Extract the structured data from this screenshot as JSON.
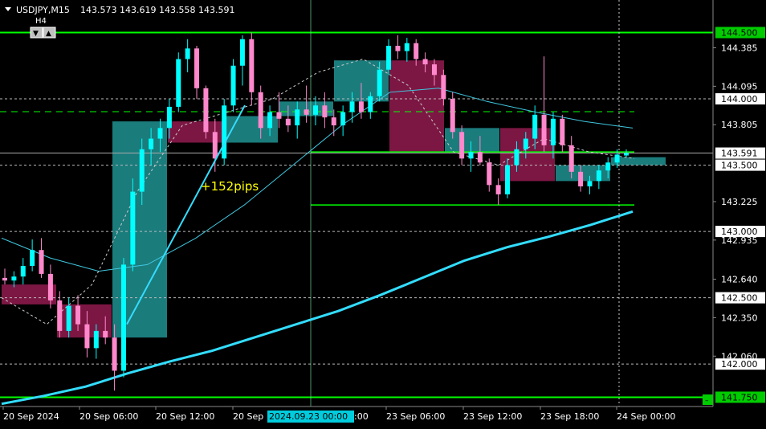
{
  "header": {
    "symbol": "USDJPY,M15",
    "ohlc": "143.573 143.619 143.558 143.591",
    "tf_label": "H4",
    "btn_down": "▼",
    "btn_up": "▲"
  },
  "annotation": {
    "text": "+152pips",
    "color": "#ffff00"
  },
  "colors": {
    "background": "#000000",
    "bull": "#00ffff",
    "bear": "#ff88cc",
    "box_bull": "#1e8a8a",
    "box_bear": "#8a1a4a",
    "level_line": "#00ff00",
    "ma_slow": "#33ddff",
    "ma_mid": "#40c8e0",
    "ma_fast": "#cccccc",
    "price_line": "#aaaaaa"
  },
  "chart_data": {
    "type": "candlestick",
    "symbol": "USDJPY",
    "timeframe": "M15",
    "ylim": [
      141.68,
      144.6
    ],
    "y_tick_labels": [
      "144.385",
      "144.095",
      "143.805",
      "143.225",
      "142.935",
      "142.640",
      "142.350",
      "142.060"
    ],
    "x_tick_labels": [
      "20 Sep 2024",
      "20 Sep 06:00",
      "20 Sep 12:00",
      "20 Sep",
      "23 Sep 06:00",
      "23 Sep 12:00",
      "23 Sep 18:00",
      "24 Sep 00:00"
    ],
    "x_tick_partial": ":00",
    "crosshair_time_label": "2024.09.23 00:00",
    "levels": [
      {
        "price": 144.5,
        "label": "144.500",
        "style": "solid-green"
      },
      {
        "price": 144.0,
        "label": "144.000",
        "style": "dotted-white"
      },
      {
        "price": 143.5,
        "label": "143.500",
        "style": "dotted-white"
      },
      {
        "price": 143.0,
        "label": "143.000",
        "style": "dotted-white"
      },
      {
        "price": 142.5,
        "label": "142.500",
        "style": "dotted-white"
      },
      {
        "price": 142.0,
        "label": "142.000",
        "style": "dotted-white"
      },
      {
        "price": 141.75,
        "label": "141.750",
        "style": "solid-green"
      }
    ],
    "current_price": {
      "price": 143.591,
      "label": "143.591"
    },
    "h4_boxes": [
      {
        "o": 142.6,
        "h": 142.9,
        "l": 142.3,
        "c": 142.45
      },
      {
        "o": 142.45,
        "h": 142.6,
        "l": 142.06,
        "c": 142.2
      },
      {
        "o": 142.2,
        "h": 143.83,
        "l": 141.8,
        "c": 143.83
      },
      {
        "o": 143.83,
        "h": 144.4,
        "l": 143.5,
        "c": 143.67
      },
      {
        "o": 143.67,
        "h": 144.3,
        "l": 143.6,
        "c": 143.87
      },
      {
        "o": 143.87,
        "h": 144.08,
        "l": 143.7,
        "c": 143.98
      },
      {
        "o": 143.98,
        "h": 144.45,
        "l": 143.9,
        "c": 144.29
      },
      {
        "o": 144.29,
        "h": 144.3,
        "l": 143.5,
        "c": 143.6
      },
      {
        "o": 143.6,
        "h": 143.8,
        "l": 143.3,
        "c": 143.78
      },
      {
        "o": 143.78,
        "h": 144.2,
        "l": 143.3,
        "c": 143.38
      },
      {
        "o": 143.38,
        "h": 143.6,
        "l": 143.28,
        "c": 143.5
      },
      {
        "o": 143.5,
        "h": 143.62,
        "l": 143.45,
        "c": 143.56
      }
    ],
    "ma_slow": [
      141.7,
      141.76,
      141.83,
      141.93,
      142.02,
      142.1,
      142.2,
      142.3,
      142.4,
      142.52,
      142.65,
      142.78,
      142.88,
      142.96,
      143.05,
      143.15
    ],
    "ma_mid": [
      142.95,
      142.8,
      142.7,
      142.75,
      142.95,
      143.2,
      143.5,
      143.8,
      144.05,
      144.08,
      143.98,
      143.9,
      143.83,
      143.78
    ],
    "ma_fast": [
      142.5,
      142.3,
      142.6,
      143.3,
      143.8,
      143.9,
      144.0,
      144.2,
      144.3,
      144.1,
      143.6,
      143.5,
      143.7,
      143.6,
      143.55
    ],
    "trend_line": {
      "from": 142.3,
      "to": 144.0,
      "label": "+152pips"
    },
    "green_levels_short": [
      144.5,
      143.6,
      143.2
    ],
    "dashed_level": 144.0,
    "candles": [
      {
        "o": 142.65,
        "h": 142.72,
        "l": 142.6,
        "c": 142.63
      },
      {
        "o": 142.63,
        "h": 142.7,
        "l": 142.58,
        "c": 142.66
      },
      {
        "o": 142.66,
        "h": 142.8,
        "l": 142.6,
        "c": 142.74
      },
      {
        "o": 142.74,
        "h": 142.94,
        "l": 142.7,
        "c": 142.86
      },
      {
        "o": 142.86,
        "h": 142.95,
        "l": 142.65,
        "c": 142.68
      },
      {
        "o": 142.68,
        "h": 142.75,
        "l": 142.42,
        "c": 142.48
      },
      {
        "o": 142.48,
        "h": 142.55,
        "l": 142.2,
        "c": 142.25
      },
      {
        "o": 142.25,
        "h": 142.5,
        "l": 142.2,
        "c": 142.44
      },
      {
        "o": 142.44,
        "h": 142.52,
        "l": 142.25,
        "c": 142.3
      },
      {
        "o": 142.3,
        "h": 142.4,
        "l": 142.05,
        "c": 142.12
      },
      {
        "o": 142.12,
        "h": 142.3,
        "l": 142.04,
        "c": 142.25
      },
      {
        "o": 142.25,
        "h": 142.36,
        "l": 142.15,
        "c": 142.2
      },
      {
        "o": 142.2,
        "h": 142.3,
        "l": 141.8,
        "c": 141.95
      },
      {
        "o": 141.95,
        "h": 142.8,
        "l": 141.9,
        "c": 142.75
      },
      {
        "o": 142.75,
        "h": 143.4,
        "l": 142.7,
        "c": 143.3
      },
      {
        "o": 143.3,
        "h": 143.7,
        "l": 143.2,
        "c": 143.62
      },
      {
        "o": 143.62,
        "h": 143.78,
        "l": 143.5,
        "c": 143.7
      },
      {
        "o": 143.7,
        "h": 143.85,
        "l": 143.6,
        "c": 143.78
      },
      {
        "o": 143.78,
        "h": 144.0,
        "l": 143.7,
        "c": 143.94
      },
      {
        "o": 143.94,
        "h": 144.35,
        "l": 143.9,
        "c": 144.3
      },
      {
        "o": 144.3,
        "h": 144.45,
        "l": 144.2,
        "c": 144.38
      },
      {
        "o": 144.38,
        "h": 144.4,
        "l": 144.0,
        "c": 144.08
      },
      {
        "o": 144.08,
        "h": 144.1,
        "l": 143.7,
        "c": 143.75
      },
      {
        "o": 143.75,
        "h": 143.85,
        "l": 143.45,
        "c": 143.55
      },
      {
        "o": 143.55,
        "h": 144.0,
        "l": 143.5,
        "c": 143.95
      },
      {
        "o": 143.95,
        "h": 144.3,
        "l": 143.9,
        "c": 144.25
      },
      {
        "o": 144.25,
        "h": 144.48,
        "l": 144.1,
        "c": 144.45
      },
      {
        "o": 144.45,
        "h": 144.5,
        "l": 143.95,
        "c": 144.05
      },
      {
        "o": 144.05,
        "h": 144.1,
        "l": 143.7,
        "c": 143.78
      },
      {
        "o": 143.78,
        "h": 143.95,
        "l": 143.72,
        "c": 143.9
      },
      {
        "o": 143.9,
        "h": 144.05,
        "l": 143.78,
        "c": 143.85
      },
      {
        "o": 143.85,
        "h": 143.95,
        "l": 143.75,
        "c": 143.8
      },
      {
        "o": 143.8,
        "h": 143.98,
        "l": 143.7,
        "c": 143.92
      },
      {
        "o": 143.92,
        "h": 144.1,
        "l": 143.82,
        "c": 143.88
      },
      {
        "o": 143.88,
        "h": 144.02,
        "l": 143.8,
        "c": 143.95
      },
      {
        "o": 143.95,
        "h": 144.05,
        "l": 143.78,
        "c": 143.86
      },
      {
        "o": 143.86,
        "h": 143.92,
        "l": 143.72,
        "c": 143.8
      },
      {
        "o": 143.8,
        "h": 143.95,
        "l": 143.72,
        "c": 143.9
      },
      {
        "o": 143.9,
        "h": 144.05,
        "l": 143.82,
        "c": 143.98
      },
      {
        "o": 143.98,
        "h": 144.12,
        "l": 143.85,
        "c": 143.9
      },
      {
        "o": 143.9,
        "h": 144.05,
        "l": 143.85,
        "c": 144.02
      },
      {
        "o": 144.02,
        "h": 144.28,
        "l": 143.98,
        "c": 144.22
      },
      {
        "o": 144.22,
        "h": 144.45,
        "l": 144.18,
        "c": 144.4
      },
      {
        "o": 144.4,
        "h": 144.48,
        "l": 144.3,
        "c": 144.36
      },
      {
        "o": 144.36,
        "h": 144.46,
        "l": 144.28,
        "c": 144.42
      },
      {
        "o": 144.42,
        "h": 144.45,
        "l": 144.25,
        "c": 144.3
      },
      {
        "o": 144.3,
        "h": 144.35,
        "l": 144.2,
        "c": 144.26
      },
      {
        "o": 144.26,
        "h": 144.3,
        "l": 144.1,
        "c": 144.18
      },
      {
        "o": 144.18,
        "h": 144.22,
        "l": 143.95,
        "c": 144.0
      },
      {
        "o": 144.0,
        "h": 144.05,
        "l": 143.7,
        "c": 143.75
      },
      {
        "o": 143.75,
        "h": 143.8,
        "l": 143.5,
        "c": 143.55
      },
      {
        "o": 143.55,
        "h": 143.68,
        "l": 143.45,
        "c": 143.6
      },
      {
        "o": 143.6,
        "h": 143.72,
        "l": 143.5,
        "c": 143.52
      },
      {
        "o": 143.52,
        "h": 143.55,
        "l": 143.3,
        "c": 143.35
      },
      {
        "o": 143.35,
        "h": 143.4,
        "l": 143.2,
        "c": 143.28
      },
      {
        "o": 143.28,
        "h": 143.55,
        "l": 143.25,
        "c": 143.5
      },
      {
        "o": 143.5,
        "h": 143.68,
        "l": 143.45,
        "c": 143.62
      },
      {
        "o": 143.62,
        "h": 143.75,
        "l": 143.55,
        "c": 143.7
      },
      {
        "o": 143.7,
        "h": 143.95,
        "l": 143.62,
        "c": 143.88
      },
      {
        "o": 143.88,
        "h": 144.32,
        "l": 143.6,
        "c": 143.65
      },
      {
        "o": 143.65,
        "h": 143.9,
        "l": 143.55,
        "c": 143.85
      },
      {
        "o": 143.85,
        "h": 143.88,
        "l": 143.6,
        "c": 143.65
      },
      {
        "o": 143.65,
        "h": 143.72,
        "l": 143.4,
        "c": 143.45
      },
      {
        "o": 143.45,
        "h": 143.5,
        "l": 143.3,
        "c": 143.34
      },
      {
        "o": 143.34,
        "h": 143.42,
        "l": 143.28,
        "c": 143.38
      },
      {
        "o": 143.38,
        "h": 143.5,
        "l": 143.32,
        "c": 143.46
      },
      {
        "o": 143.46,
        "h": 143.56,
        "l": 143.4,
        "c": 143.52
      },
      {
        "o": 143.52,
        "h": 143.62,
        "l": 143.48,
        "c": 143.58
      },
      {
        "o": 143.573,
        "h": 143.619,
        "l": 143.558,
        "c": 143.591
      }
    ]
  }
}
